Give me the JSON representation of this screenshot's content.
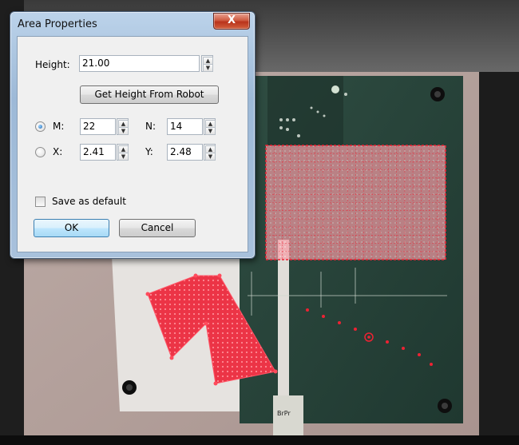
{
  "dialog": {
    "title": "Area Properties",
    "close_label": "X",
    "height_label": "Height:",
    "height_value": "21.00",
    "get_height_button": "Get Height From Robot",
    "m_label": "M:",
    "m_value": "22",
    "n_label": "N:",
    "n_value": "14",
    "x_label": "X:",
    "x_value": "2.41",
    "y_label": "Y:",
    "y_value": "2.48",
    "selected_mode": "M",
    "save_default_label": "Save as default",
    "save_default_checked": false,
    "ok_label": "OK",
    "cancel_label": "Cancel"
  },
  "camera_view": {
    "pcb_label": "BrPr",
    "grid_color": "#e8253a",
    "area_grid": {
      "columns": 22,
      "rows": 14
    }
  },
  "colors": {
    "board": "#27433a",
    "overlay": "#ee2233",
    "mat": "#b9a8a3"
  }
}
